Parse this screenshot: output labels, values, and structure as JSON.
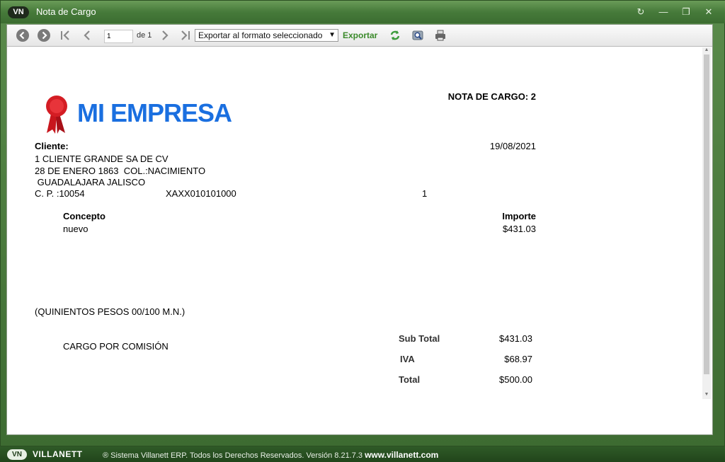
{
  "window": {
    "logo": "VN",
    "title": "Nota de Cargo",
    "controls": {
      "refresh_icon": "↻",
      "minimize_icon": "—",
      "restore_icon": "❐",
      "close_icon": "✕"
    }
  },
  "toolbar": {
    "page_value": "1",
    "page_total": "de 1",
    "export_format": "Exportar al formato seleccionado",
    "export_label": "Exportar",
    "icons": [
      "back-icon",
      "forward-icon",
      "first-page-icon",
      "prev-page-icon",
      "next-page-icon",
      "last-page-icon",
      "refresh-icon",
      "search-icon",
      "print-icon"
    ]
  },
  "document": {
    "company_name": "MI EMPRESA",
    "doc_title": "NOTA DE CARGO: 2",
    "client_label": "Cliente:",
    "date": "19/08/2021",
    "client_name": "1 CLIENTE GRANDE SA DE CV",
    "address_line1": "28 DE ENERO 1863  COL.:NACIMIENTO",
    "address_line2": " GUADALAJARA JALISCO",
    "cp": "C. P. :10054",
    "rfc": "XAXX010101000",
    "client_number": "1",
    "concept_header": "Concepto",
    "amount_header": "Importe",
    "items": [
      {
        "concept": "nuevo",
        "amount": "$431.03"
      }
    ],
    "amount_in_words": "(QUINIENTOS PESOS 00/100 M.N.)",
    "charge_type": "CARGO POR COMISIÓN",
    "subtotal_label": "Sub Total",
    "subtotal_value": "$431.03",
    "iva_label": "IVA",
    "iva_value": "$68.97",
    "total_label": "Total",
    "total_value": "$500.00"
  },
  "footer": {
    "logo": "VN",
    "brand": "VILLANETT",
    "text": "® Sistema Villanett ERP. Todos los Derechos Reservados.  Versión 8.21.7.3",
    "url": "www.villanett.com"
  },
  "colors": {
    "frame_green": "#467a3a",
    "export_green": "#3a8a2a",
    "logo_blue": "#1a6fe0",
    "ribbon_red": "#c8161d"
  }
}
